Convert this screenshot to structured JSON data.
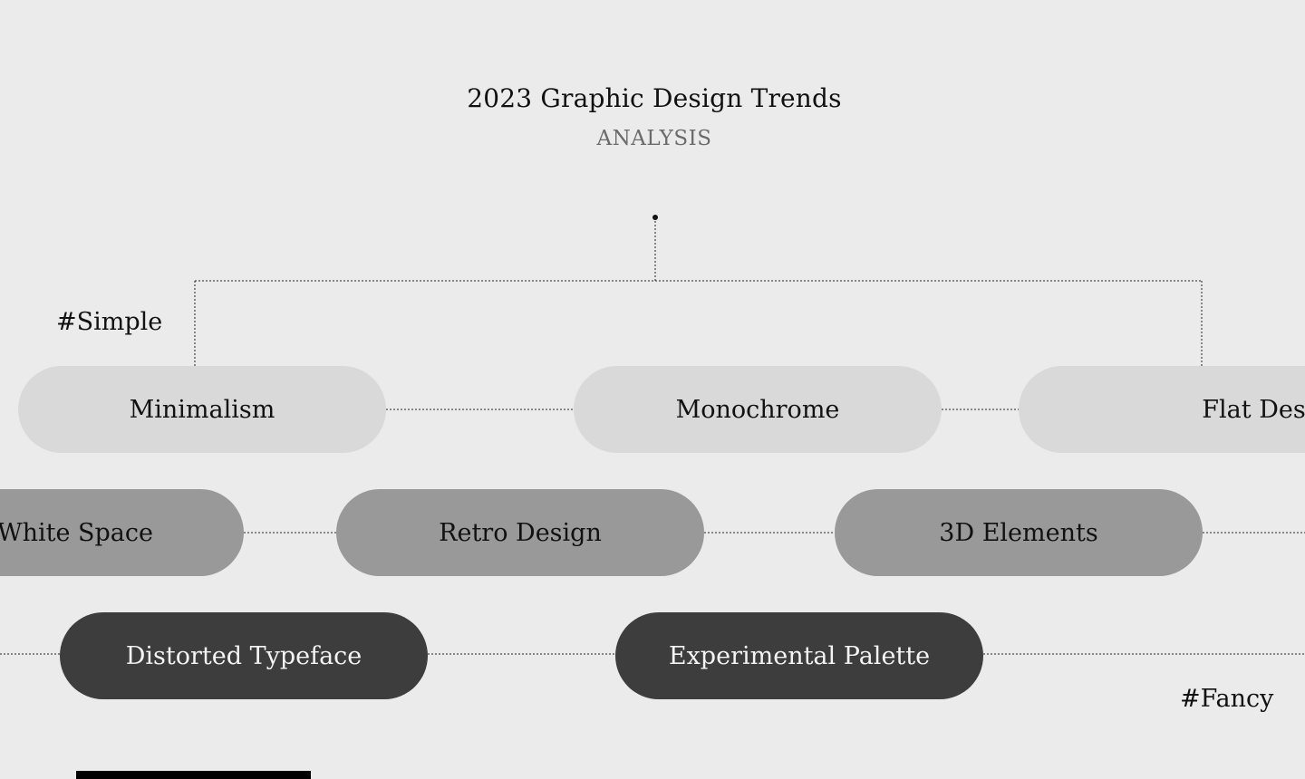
{
  "header": {
    "title": "2023 Graphic Design Trends",
    "subtitle": "ANALYSIS"
  },
  "tags": {
    "simple": "#Simple",
    "fancy": "#Fancy"
  },
  "rows": {
    "light": [
      "Minimalism",
      "Monochrome",
      "Flat Design"
    ],
    "mid": [
      "White Space",
      "Retro Design",
      "3D Elements"
    ],
    "dark": [
      "Distorted Typeface",
      "Experimental Palette"
    ]
  },
  "colors": {
    "background": "#ebebeb",
    "light_pill": "#d9d9d9",
    "mid_pill": "#999999",
    "dark_pill": "#3d3d3d"
  }
}
